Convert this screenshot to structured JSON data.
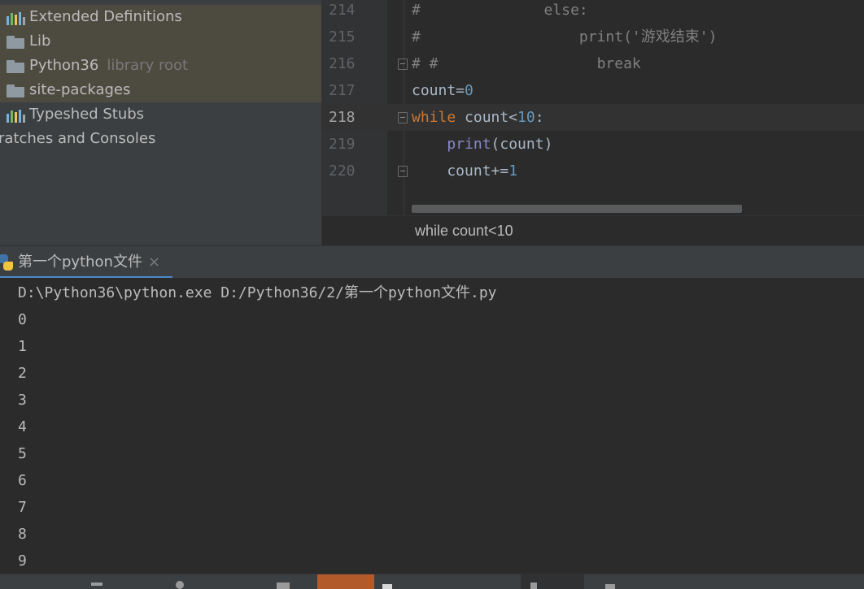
{
  "project_tree": {
    "items": [
      {
        "label": "Extended Definitions",
        "hint": "",
        "icon": "library-icon"
      },
      {
        "label": "Lib",
        "hint": "",
        "icon": "folder-icon"
      },
      {
        "label": "Python36",
        "hint": "library root",
        "icon": "folder-icon"
      },
      {
        "label": "site-packages",
        "hint": "",
        "icon": "folder-icon"
      },
      {
        "label": "Typeshed Stubs",
        "hint": "",
        "icon": "library-icon"
      },
      {
        "label": "ratches and Consoles",
        "hint": "",
        "icon": ""
      }
    ]
  },
  "editor": {
    "lines": [
      {
        "number": "214",
        "code": "#              else:"
      },
      {
        "number": "215",
        "code": "#                  print('游戏结束')"
      },
      {
        "number": "216",
        "code": "# #                  break"
      },
      {
        "number": "217",
        "code": "count=0"
      },
      {
        "number": "218",
        "code": "while count<10:"
      },
      {
        "number": "219",
        "code": "    print(count)"
      },
      {
        "number": "220",
        "code": "    count+=1"
      }
    ],
    "breadcrumb": "while count<10"
  },
  "run_panel": {
    "tab_label": "第一个python文件",
    "tab_close": "×",
    "command": "D:\\Python36\\python.exe D:/Python36/2/第一个python文件.py",
    "output": [
      "0",
      "1",
      "2",
      "3",
      "4",
      "5",
      "6",
      "7",
      "8",
      "9"
    ]
  },
  "colors": {
    "editor_bg": "#2b2b2b",
    "panel_bg": "#3c3f41",
    "keyword": "#cc7832",
    "number": "#6897bb",
    "builtin": "#8888c6",
    "comment": "#808080",
    "tab_underline": "#4a88c7"
  }
}
